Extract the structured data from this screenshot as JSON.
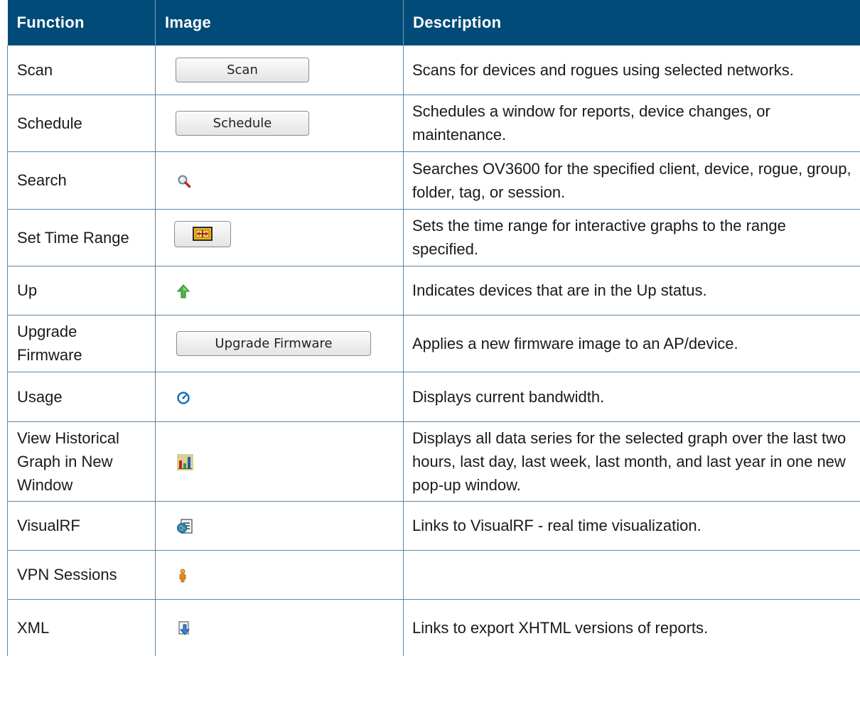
{
  "headers": {
    "function": "Function",
    "image": "Image",
    "description": "Description"
  },
  "rows": [
    {
      "function": "Scan",
      "button_label": "Scan",
      "description": "Scans for devices and rogues using selected networks."
    },
    {
      "function": "Schedule",
      "button_label": "Schedule",
      "description": "Schedules a window for reports, device changes, or maintenance."
    },
    {
      "function": "Search",
      "icon": "magnifier-icon",
      "description": "Searches OV3600 for the specified client, device, rogue, group, folder, tag, or session."
    },
    {
      "function": "Set Time Range",
      "icon": "time-range-icon",
      "description": "Sets the time range for interactive graphs to the range specified."
    },
    {
      "function": "Up",
      "icon": "green-up-arrow-icon",
      "description": "Indicates devices that are in the Up status."
    },
    {
      "function": "Upgrade Firmware",
      "button_label": "Upgrade Firmware",
      "description": "Applies a new firmware image to an AP/device."
    },
    {
      "function": "Usage",
      "icon": "gauge-icon",
      "description": "Displays current bandwidth."
    },
    {
      "function": "View Historical Graph in New Window",
      "icon": "bar-chart-icon",
      "description": "Displays all data series for the selected graph over the last two hours, last day, last week, last month, and last year in one new pop-up window."
    },
    {
      "function": "VisualRF",
      "icon": "visualrf-icon",
      "description": "Links to VisualRF - real time visualization."
    },
    {
      "function": "VPN Sessions",
      "icon": "person-icon",
      "description": ""
    },
    {
      "function": "XML",
      "icon": "export-icon",
      "description": "Links to export XHTML versions of reports."
    }
  ],
  "colors": {
    "header_bg": "#004b78",
    "header_text": "#ffffff",
    "grid": "#5a86aa"
  }
}
